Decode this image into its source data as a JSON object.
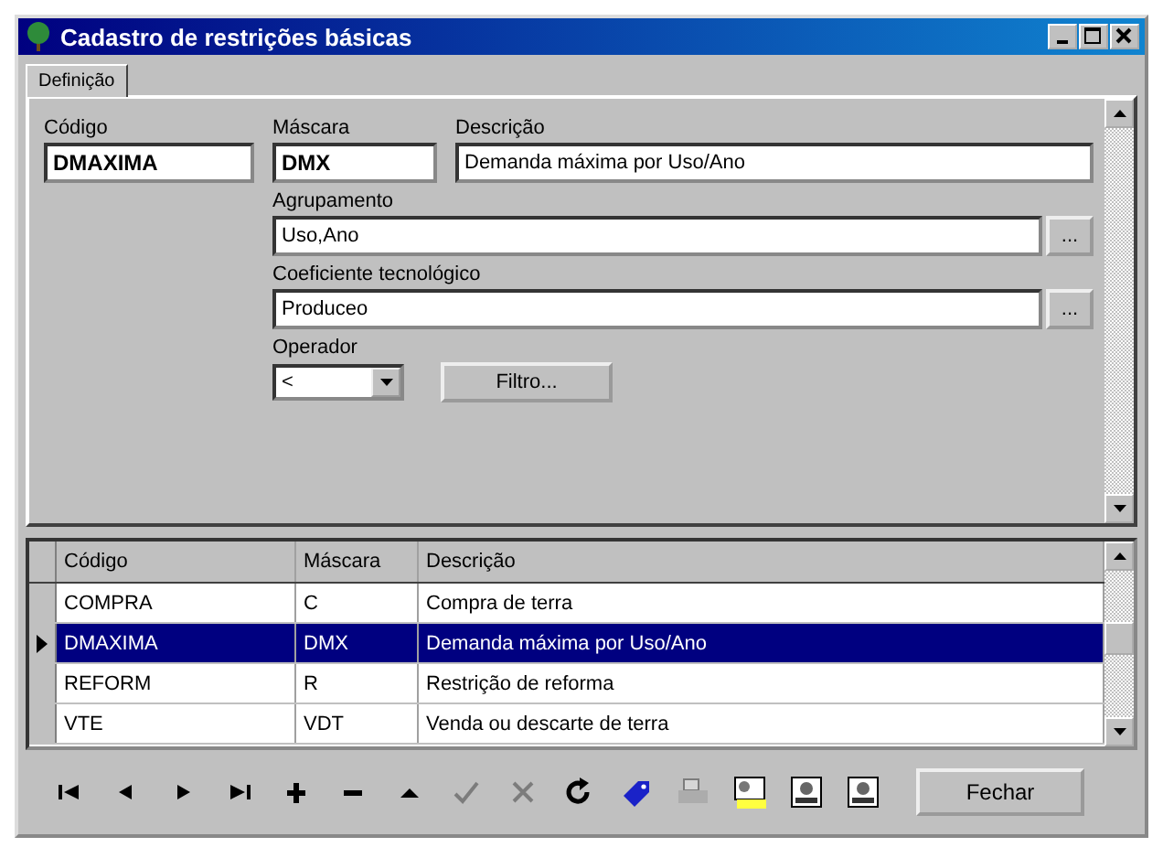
{
  "window": {
    "title": "Cadastro de restrições básicas"
  },
  "tabs": [
    {
      "label": "Definição",
      "selected": true
    }
  ],
  "form": {
    "codigo": {
      "label": "Código",
      "value": "DMAXIMA"
    },
    "mascara": {
      "label": "Máscara",
      "value": "DMX"
    },
    "descricao": {
      "label": "Descrição",
      "value": "Demanda máxima por Uso/Ano"
    },
    "agrupamento": {
      "label": "Agrupamento",
      "value": "Uso,Ano",
      "button": "..."
    },
    "coeficiente": {
      "label": "Coeficiente tecnológico",
      "value": "Produceo",
      "button": "..."
    },
    "operador": {
      "label": "Operador",
      "value": "<"
    },
    "filtro_button": "Filtro..."
  },
  "table": {
    "columns": [
      "Código",
      "Máscara",
      "Descrição"
    ],
    "rows": [
      {
        "cells": [
          "COMPRA",
          "C",
          "Compra de terra"
        ],
        "selected": false
      },
      {
        "cells": [
          "DMAXIMA",
          "DMX",
          "Demanda máxima por Uso/Ano"
        ],
        "selected": true
      },
      {
        "cells": [
          "REFORM",
          "R",
          "Restrição de reforma"
        ],
        "selected": false
      },
      {
        "cells": [
          "VTE",
          "VDT",
          "Venda ou descarte de terra"
        ],
        "selected": false
      }
    ]
  },
  "toolbar": [
    {
      "kind": "first",
      "disabled": false
    },
    {
      "kind": "prior",
      "disabled": false
    },
    {
      "kind": "next",
      "disabled": false
    },
    {
      "kind": "last",
      "disabled": false
    },
    {
      "kind": "insert",
      "disabled": false
    },
    {
      "kind": "delete",
      "disabled": false
    },
    {
      "kind": "edit",
      "disabled": false
    },
    {
      "kind": "post",
      "disabled": true
    },
    {
      "kind": "cancel",
      "disabled": true
    },
    {
      "kind": "refresh",
      "disabled": false
    },
    {
      "kind": "tag",
      "disabled": false
    },
    {
      "kind": "print",
      "disabled": true
    },
    {
      "kind": "filter",
      "disabled": false
    },
    {
      "kind": "image",
      "disabled": false
    },
    {
      "kind": "image",
      "disabled": false
    }
  ],
  "close_button": "Fechar"
}
